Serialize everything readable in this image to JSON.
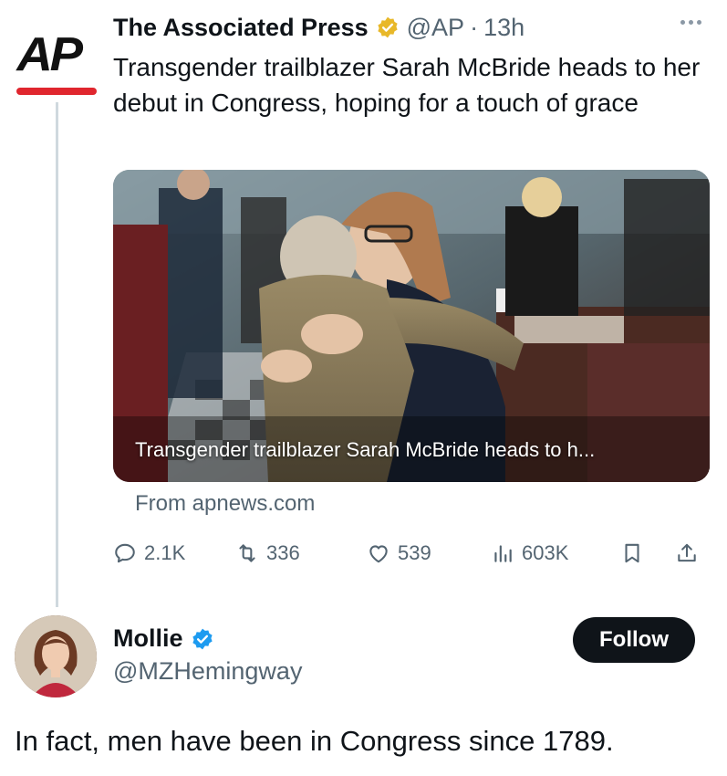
{
  "original_tweet": {
    "logo_text": "AP",
    "author_name": "The Associated Press",
    "verified_badge": "gold-checkmark",
    "handle": "@AP",
    "separator": "·",
    "time": "13h",
    "text": "Transgender trailblazer Sarah McBride heads to her debut in Congress, hoping for a touch of grace",
    "media": {
      "caption": "Transgender trailblazer Sarah McBride heads to h..."
    },
    "source": "From apnews.com",
    "actions": {
      "replies": "2.1K",
      "reposts": "336",
      "likes": "539",
      "views": "603K"
    }
  },
  "reply": {
    "author_name": "Mollie",
    "verified_badge": "blue-checkmark",
    "handle": "@MZHemingway",
    "follow_label": "Follow",
    "text": "In fact, men have been in Congress since 1789."
  },
  "colors": {
    "text_primary": "#0f1419",
    "text_secondary": "#536471",
    "ap_red": "#e0262e",
    "gold_badge": "#e8b829",
    "blue_badge": "#1d9bf0",
    "follow_button": "#0f1419"
  }
}
